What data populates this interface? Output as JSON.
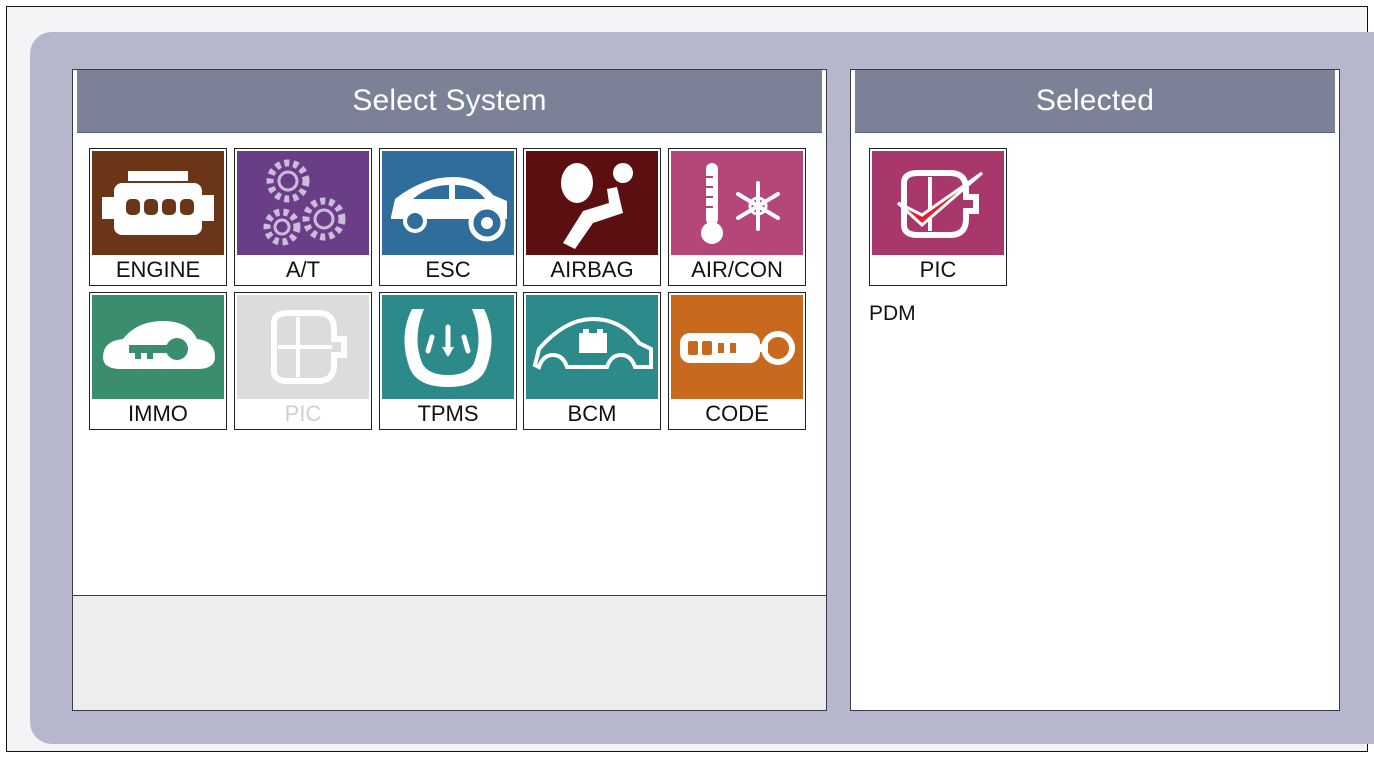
{
  "select_panel": {
    "title": "Select System",
    "tiles": [
      {
        "label": "ENGINE",
        "icon": "engine-icon",
        "color": "#6b3517",
        "enabled": true
      },
      {
        "label": "A/T",
        "icon": "gears-icon",
        "color": "#6a3e87",
        "enabled": true
      },
      {
        "label": "ESC",
        "icon": "car-brake-icon",
        "color": "#2f6d9a",
        "enabled": true
      },
      {
        "label": "AIRBAG",
        "icon": "airbag-icon",
        "color": "#5b0f10",
        "enabled": true
      },
      {
        "label": "AIR/CON",
        "icon": "thermometer-snowflake-icon",
        "color": "#b4467a",
        "enabled": true
      },
      {
        "label": "IMMO",
        "icon": "car-key-icon",
        "color": "#3a8e6d",
        "enabled": true
      },
      {
        "label": "PIC",
        "icon": "smart-key-icon",
        "color": "#dcdcdc",
        "enabled": false
      },
      {
        "label": "TPMS",
        "icon": "tire-pressure-icon",
        "color": "#2c8a8a",
        "enabled": true
      },
      {
        "label": "BCM",
        "icon": "car-battery-icon",
        "color": "#2c8a8a",
        "enabled": true
      },
      {
        "label": "CODE",
        "icon": "key-fob-icon",
        "color": "#c8691d",
        "enabled": true
      }
    ]
  },
  "selected_panel": {
    "title": "Selected",
    "tile": {
      "label": "PIC",
      "icon": "smart-key-check-icon",
      "color": "#a8386c",
      "check_color": "#e0202a"
    },
    "caption": "PDM"
  }
}
